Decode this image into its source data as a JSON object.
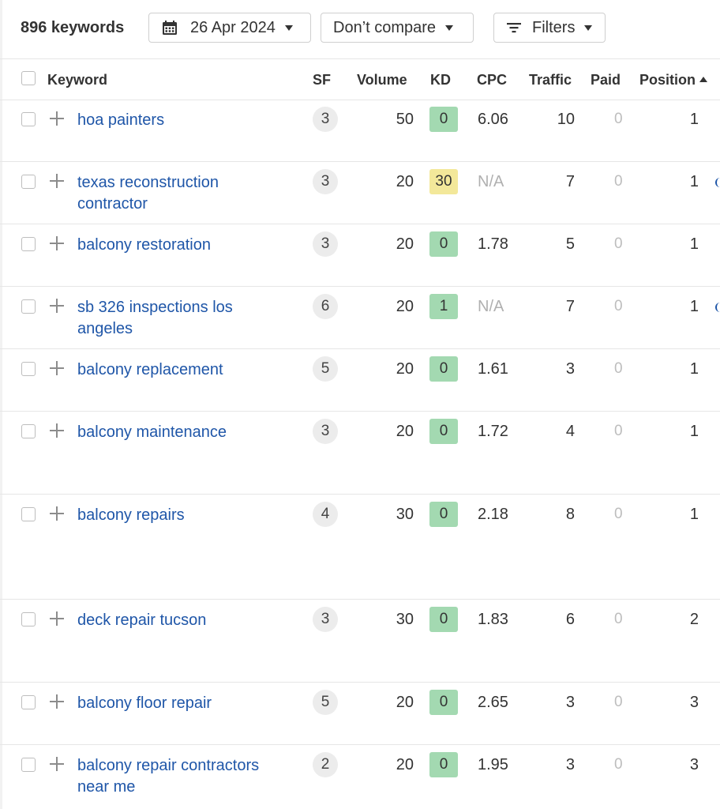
{
  "toolbar": {
    "keyword_count": "896 keywords",
    "date_label": "26 Apr 2024",
    "compare_label": "Don’t compare",
    "filters_label": "Filters"
  },
  "columns": {
    "keyword": "Keyword",
    "sf": "SF",
    "volume": "Volume",
    "kd": "KD",
    "cpc": "CPC",
    "traffic": "Traffic",
    "paid": "Paid",
    "position": "Position"
  },
  "colors": {
    "kd_green": "#a3d9b1",
    "kd_yellow": "#f3e89a",
    "link": "#1f56a8"
  },
  "rows": [
    {
      "keyword": "hoa painters",
      "sf": "3",
      "volume": "50",
      "kd": "0",
      "kd_color": "green",
      "cpc": "6.06",
      "traffic": "10",
      "paid": "0",
      "position": "1"
    },
    {
      "keyword": "texas reconstruction contractor",
      "sf": "3",
      "volume": "20",
      "kd": "30",
      "kd_color": "yellow",
      "cpc": "N/A",
      "traffic": "7",
      "paid": "0",
      "position": "1"
    },
    {
      "keyword": "balcony restoration",
      "sf": "3",
      "volume": "20",
      "kd": "0",
      "kd_color": "green",
      "cpc": "1.78",
      "traffic": "5",
      "paid": "0",
      "position": "1"
    },
    {
      "keyword": "sb 326 inspections los angeles",
      "sf": "6",
      "volume": "20",
      "kd": "1",
      "kd_color": "green",
      "cpc": "N/A",
      "traffic": "7",
      "paid": "0",
      "position": "1"
    },
    {
      "keyword": "balcony replacement",
      "sf": "5",
      "volume": "20",
      "kd": "0",
      "kd_color": "green",
      "cpc": "1.61",
      "traffic": "3",
      "paid": "0",
      "position": "1"
    },
    {
      "keyword": "balcony maintenance",
      "sf": "3",
      "volume": "20",
      "kd": "0",
      "kd_color": "green",
      "cpc": "1.72",
      "traffic": "4",
      "paid": "0",
      "position": "1"
    },
    {
      "keyword": "balcony repairs",
      "sf": "4",
      "volume": "30",
      "kd": "0",
      "kd_color": "green",
      "cpc": "2.18",
      "traffic": "8",
      "paid": "0",
      "position": "1"
    },
    {
      "keyword": "deck repair tucson",
      "sf": "3",
      "volume": "30",
      "kd": "0",
      "kd_color": "green",
      "cpc": "1.83",
      "traffic": "6",
      "paid": "0",
      "position": "2"
    },
    {
      "keyword": "balcony floor repair",
      "sf": "5",
      "volume": "20",
      "kd": "0",
      "kd_color": "green",
      "cpc": "2.65",
      "traffic": "3",
      "paid": "0",
      "position": "3"
    },
    {
      "keyword": "balcony repair contractors near me",
      "sf": "2",
      "volume": "20",
      "kd": "0",
      "kd_color": "green",
      "cpc": "1.95",
      "traffic": "3",
      "paid": "0",
      "position": "3"
    }
  ]
}
